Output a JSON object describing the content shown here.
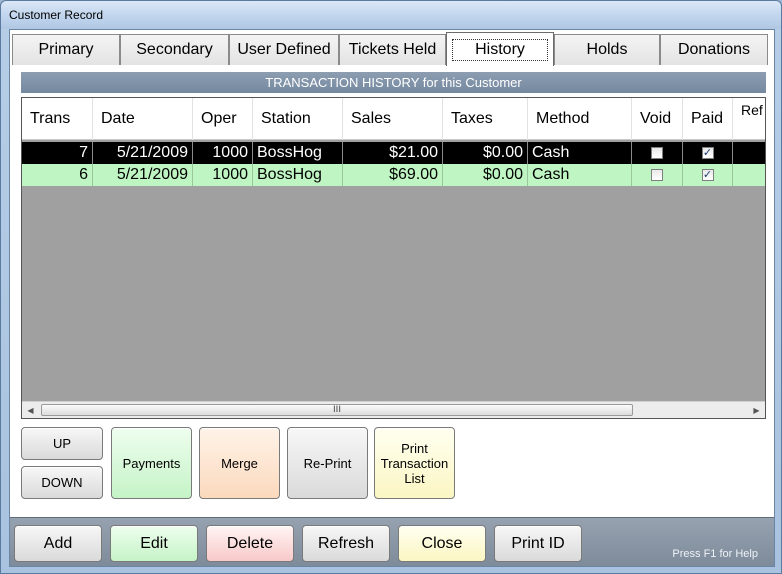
{
  "window": {
    "title": "Customer Record"
  },
  "tabs": [
    {
      "label": "Primary"
    },
    {
      "label": "Secondary"
    },
    {
      "label": "User Defined"
    },
    {
      "label": "Tickets Held"
    },
    {
      "label": "History",
      "active": true
    },
    {
      "label": "Holds"
    },
    {
      "label": "Donations"
    }
  ],
  "history": {
    "header": "TRANSACTION HISTORY for this Customer",
    "columns": [
      "Trans",
      "Date",
      "Oper",
      "Station",
      "Sales",
      "Taxes",
      "Method",
      "Void",
      "Paid",
      "Ref ID"
    ],
    "rows": [
      {
        "trans": "7",
        "date": "5/21/2009",
        "oper": "1000",
        "station": "BossHog",
        "sales": "$21.00",
        "taxes": "$0.00",
        "method": "Cash",
        "void": false,
        "paid": true,
        "selected": true
      },
      {
        "trans": "6",
        "date": "5/21/2009",
        "oper": "1000",
        "station": "BossHog",
        "sales": "$69.00",
        "taxes": "$0.00",
        "method": "Cash",
        "void": false,
        "paid": true,
        "selected": false
      }
    ],
    "scroll_thumb_glyph": "III"
  },
  "actions": {
    "up": "UP",
    "down": "DOWN",
    "payments": "Payments",
    "merge": "Merge",
    "reprint": "Re-Print",
    "print_list": "Print Transaction List"
  },
  "footer": {
    "add": "Add",
    "edit": "Edit",
    "delete": "Delete",
    "refresh": "Refresh",
    "close": "Close",
    "print_id": "Print ID",
    "help": "Press F1 for Help"
  },
  "colors": {
    "selected_row": "#000000",
    "alt_row": "#bff5c2",
    "grid_background": "#a0a0a0",
    "header_bar": "#7e8fa5"
  }
}
